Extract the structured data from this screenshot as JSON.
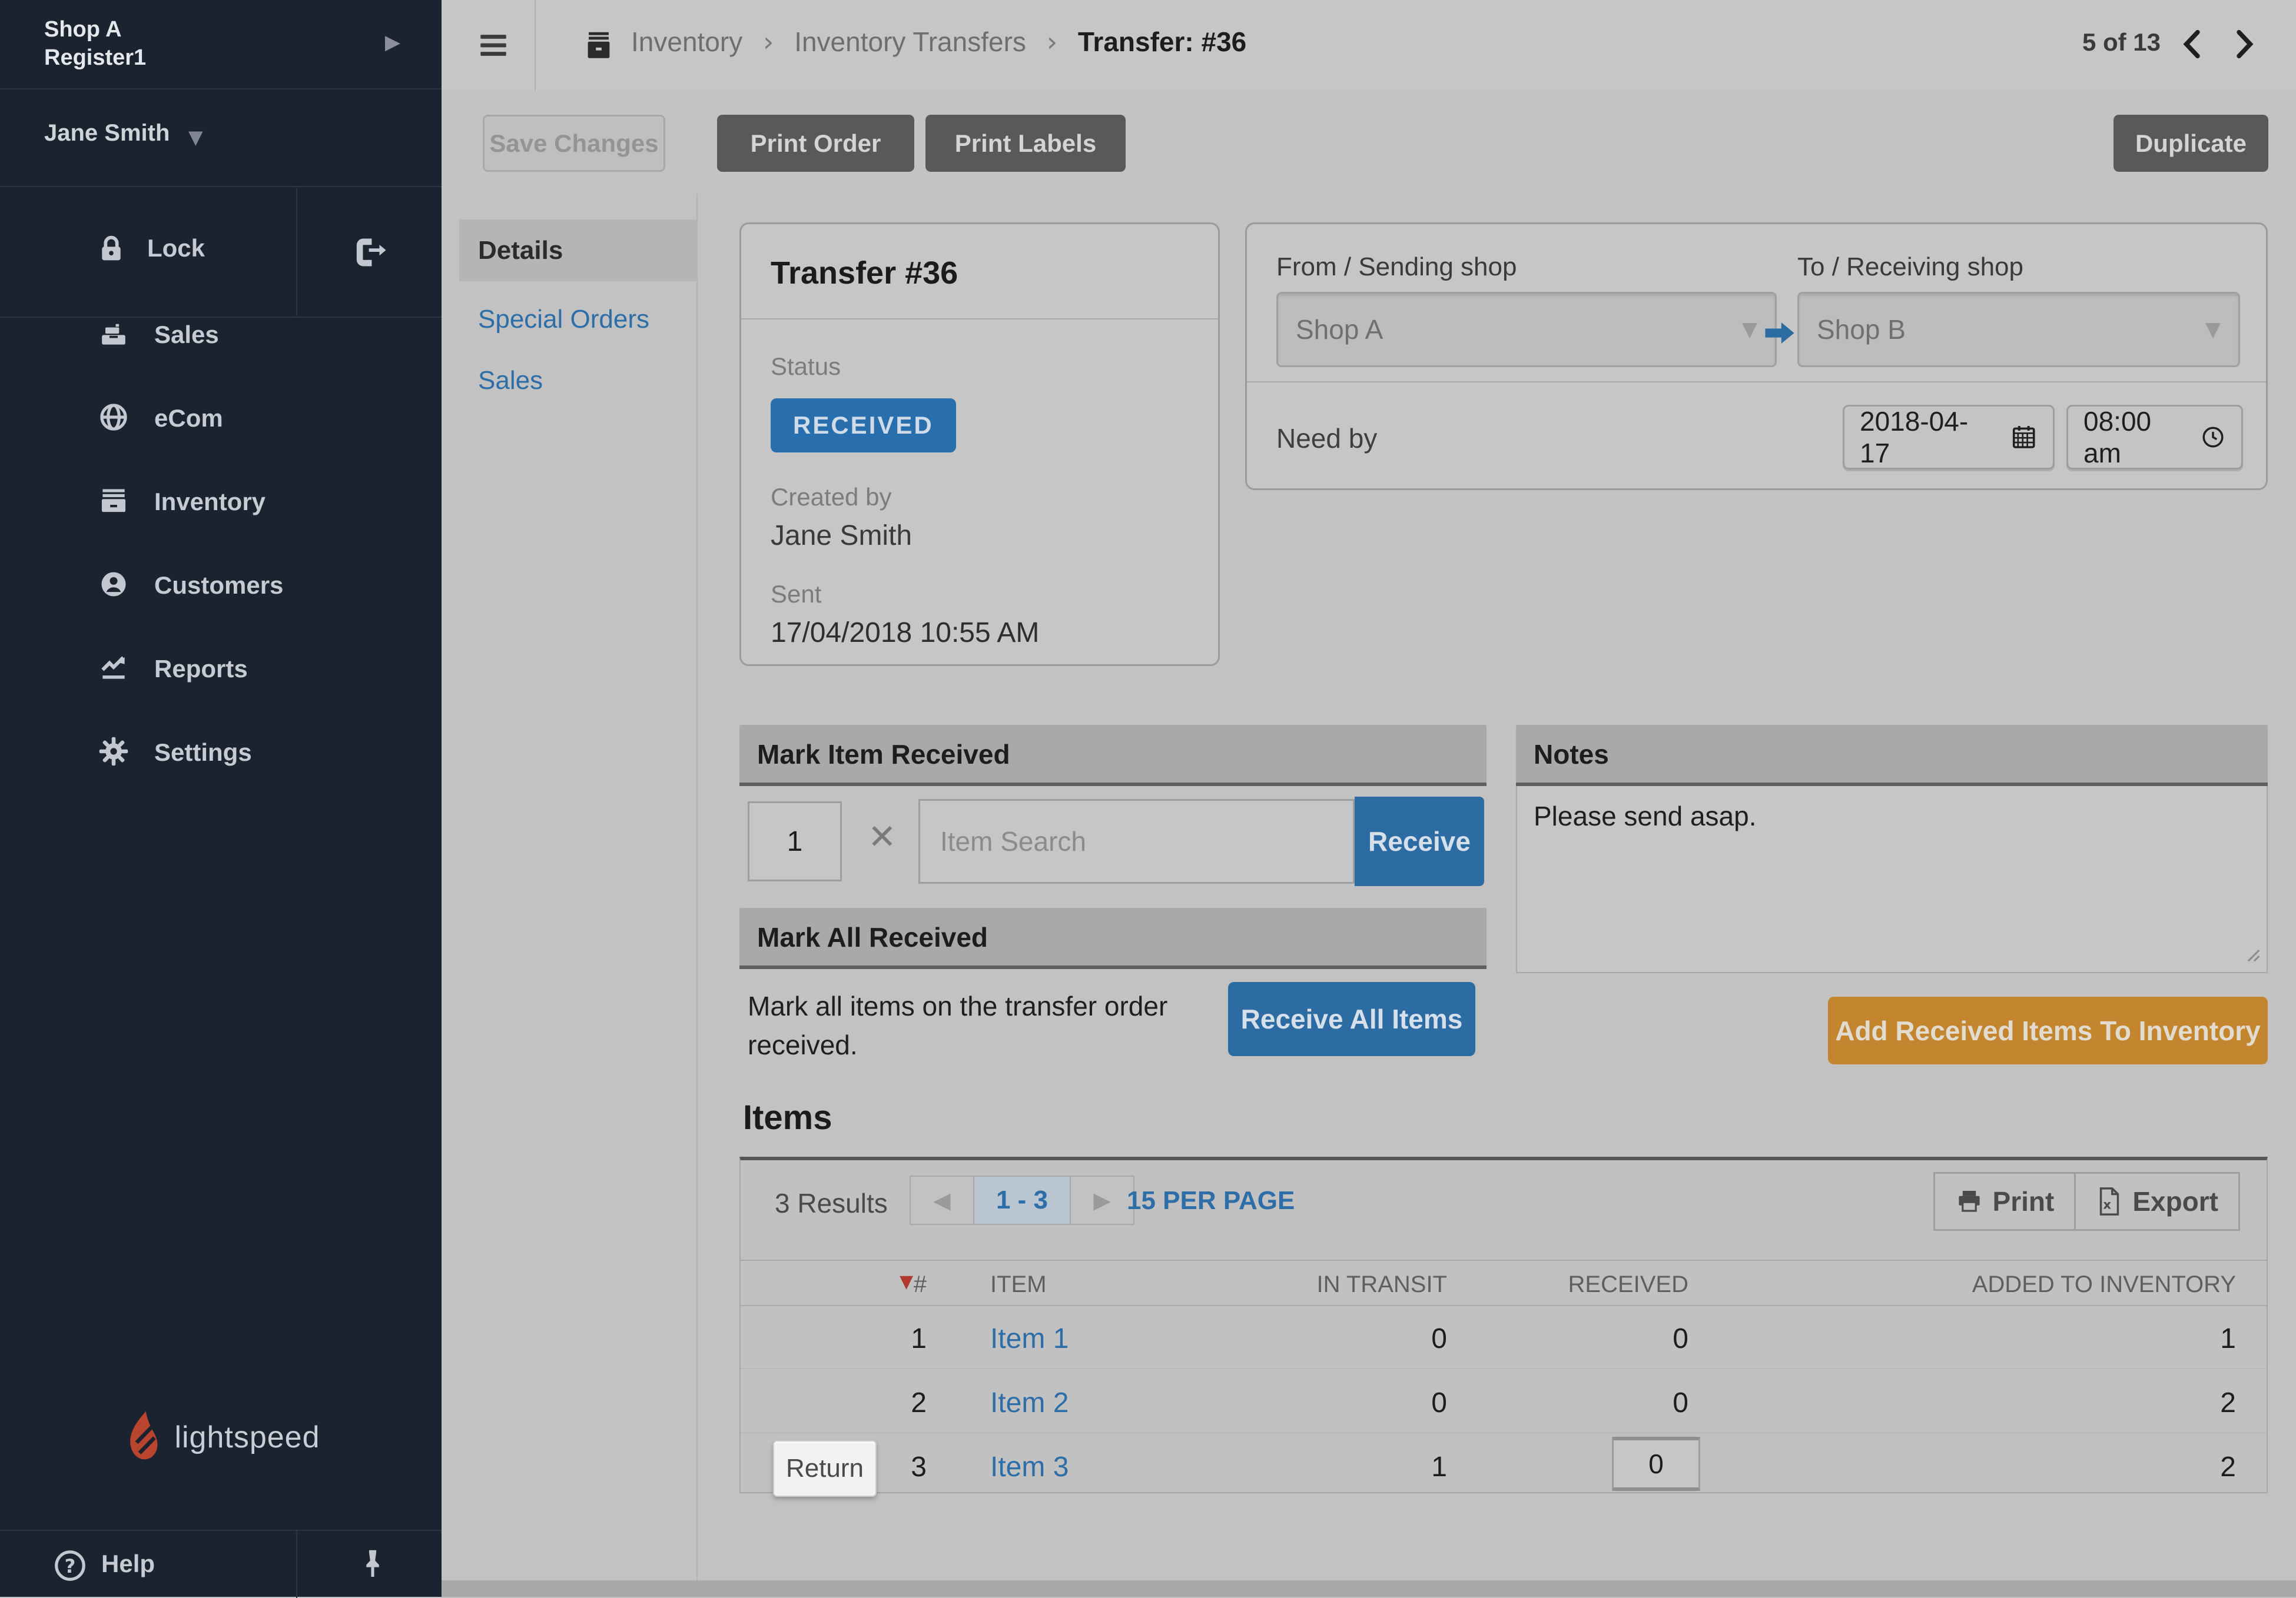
{
  "colors": {
    "sidebar_bg": "#1b2230",
    "accent_blue": "#2d6ca3",
    "badge_blue": "#2a6fad",
    "link_blue": "#2d6da8",
    "orange": "#c3862f",
    "sort_caret_red": "#b03a2e"
  },
  "sidebar": {
    "shop_line1": "Shop A",
    "shop_line2": "Register1",
    "user": "Jane Smith",
    "lock_label": "Lock",
    "items": [
      {
        "label": "Sales"
      },
      {
        "label": "eCom"
      },
      {
        "label": "Inventory"
      },
      {
        "label": "Customers"
      },
      {
        "label": "Reports"
      },
      {
        "label": "Settings"
      }
    ],
    "brand": "lightspeed",
    "help_label": "Help"
  },
  "topbar": {
    "breadcrumb": {
      "crumb1": "Inventory",
      "crumb2": "Inventory Transfers",
      "current": "Transfer: #36"
    },
    "record_pager": "5 of 13"
  },
  "actions": {
    "save": "Save Changes",
    "print_order": "Print Order",
    "print_labels": "Print Labels",
    "duplicate": "Duplicate"
  },
  "subnav": {
    "details": "Details",
    "special_orders": "Special Orders",
    "sales": "Sales"
  },
  "transfer_card": {
    "title": "Transfer #36",
    "status_label": "Status",
    "status_value": "RECEIVED",
    "created_by_label": "Created by",
    "created_by": "Jane Smith",
    "sent_label": "Sent",
    "sent_value": "17/04/2018 10:55 AM"
  },
  "shipping": {
    "from_label": "From / Sending shop",
    "from_value": "Shop A",
    "to_label": "To / Receiving shop",
    "to_value": "Shop B",
    "need_by_label": "Need by",
    "date": "2018-04-17",
    "time": "08:00 am"
  },
  "mark_item": {
    "title": "Mark Item Received",
    "qty": "1",
    "clear": "✕",
    "search_placeholder": "Item Search",
    "receive": "Receive"
  },
  "mark_all": {
    "title": "Mark All Received",
    "description": "Mark all items on the transfer order received.",
    "button": "Receive All Items"
  },
  "notes": {
    "title": "Notes",
    "value": "Please send asap."
  },
  "add_to_inventory_label": "Add Received Items To Inventory",
  "items": {
    "title": "Items",
    "results": "3 Results",
    "page_range": "1 - 3",
    "per_page": "15 PER PAGE",
    "print": "Print",
    "export": "Export",
    "columns": {
      "num": "#",
      "item": "ITEM",
      "in_transit": "IN TRANSIT",
      "received": "RECEIVED",
      "added": "ADDED TO INVENTORY"
    },
    "rows": [
      {
        "num": "1",
        "item": "Item 1",
        "in_transit": "0",
        "received": "0",
        "added": "1"
      },
      {
        "num": "2",
        "item": "Item 2",
        "in_transit": "0",
        "received": "0",
        "added": "2"
      },
      {
        "num": "3",
        "item": "Item 3",
        "in_transit": "1",
        "received": "0",
        "added": "2",
        "return_label": "Return"
      }
    ]
  }
}
